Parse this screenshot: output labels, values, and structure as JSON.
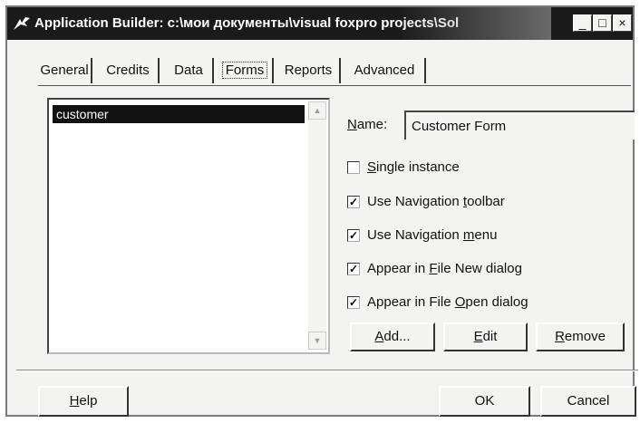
{
  "window": {
    "title": "Application Builder: c:\\мои документы\\visual foxpro projects\\Sol",
    "controls": {
      "minimize": "_",
      "maximize": "□",
      "close": "×"
    }
  },
  "tabs": [
    {
      "label": "General",
      "active": false
    },
    {
      "label": "Credits",
      "active": false
    },
    {
      "label": "Data",
      "active": false
    },
    {
      "label": "Forms",
      "active": true
    },
    {
      "label": "Reports",
      "active": false
    },
    {
      "label": "Advanced",
      "active": false
    }
  ],
  "form_list": {
    "items": [
      "customer"
    ],
    "selected": "customer"
  },
  "name_field": {
    "label_prefix": "",
    "label_underlined": "N",
    "label_suffix": "ame:",
    "value": "Customer Form"
  },
  "options": [
    {
      "pre": "",
      "u": "S",
      "post": "ingle instance",
      "checked": false
    },
    {
      "pre": "Use Navigation ",
      "u": "t",
      "post": "oolbar",
      "checked": true
    },
    {
      "pre": "Use Navigation ",
      "u": "m",
      "post": "enu",
      "checked": true
    },
    {
      "pre": "Appear in ",
      "u": "F",
      "post": "ile New dialog",
      "checked": true
    },
    {
      "pre": "Appear in File ",
      "u": "O",
      "post": "pen dialog",
      "checked": true
    }
  ],
  "list_buttons": {
    "add": {
      "u": "A",
      "post": "dd..."
    },
    "edit": {
      "u": "E",
      "post": "dit"
    },
    "remove": {
      "u": "R",
      "post": "emove"
    }
  },
  "footer_buttons": {
    "help": {
      "u": "H",
      "post": "elp"
    },
    "ok": "OK",
    "cancel": "Cancel"
  },
  "check_mark": "✓",
  "icons": {
    "app": "app-builder-icon",
    "scroll_up": "arrow-up-icon",
    "scroll_down": "arrow-down-icon"
  }
}
